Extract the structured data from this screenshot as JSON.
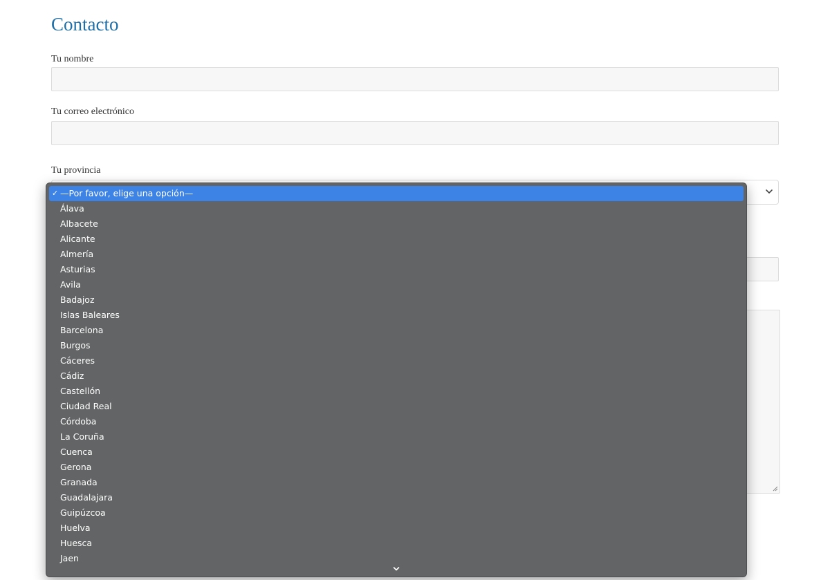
{
  "form": {
    "title": "Contacto",
    "name_label": "Tu nombre",
    "name_value": "",
    "email_label": "Tu correo electrónico",
    "email_value": "",
    "province_label": "Tu provincia",
    "province_selected": "—Por favor, elige una opción—",
    "message_value": ""
  },
  "dropdown": {
    "check_mark": "✓",
    "options": [
      "—Por favor, elige una opción—",
      "Álava",
      "Albacete",
      "Alicante",
      "Almería",
      "Asturias",
      "Avila",
      "Badajoz",
      "Islas Baleares",
      "Barcelona",
      "Burgos",
      "Cáceres",
      "Cádiz",
      "Castellón",
      "Ciudad Real",
      "Córdoba",
      "La Coruña",
      "Cuenca",
      "Gerona",
      "Granada",
      "Guadalajara",
      "Guipúzcoa",
      "Huelva",
      "Huesca",
      "Jaen"
    ]
  },
  "colors": {
    "title": "#1e6fa7",
    "dropdown_bg": "#636465",
    "dropdown_selected": "#3d83e5"
  },
  "icons": {
    "select": "chevron-down-icon",
    "scroll": "chevron-down-icon",
    "check": "check-icon",
    "resize": "resize-grip-icon"
  }
}
